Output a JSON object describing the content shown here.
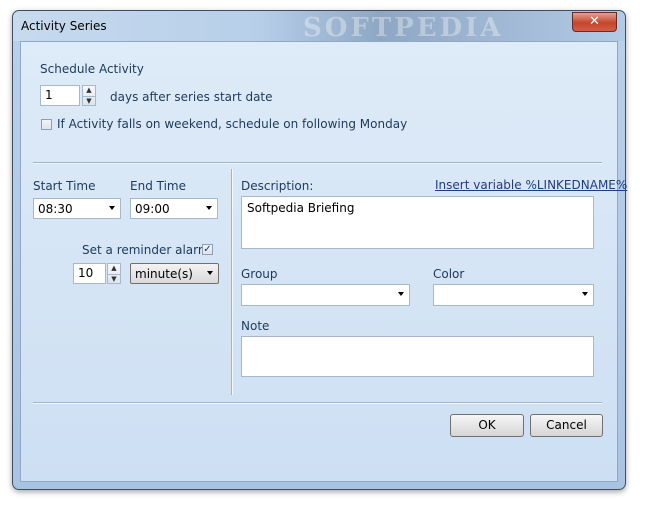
{
  "window": {
    "title": "Activity Series",
    "watermark": "SOFTPEDIA",
    "close_glyph": "✕"
  },
  "schedule": {
    "heading": "Schedule Activity",
    "days_value": "1",
    "days_label": "days after series start date",
    "weekend_label": "If Activity falls on weekend, schedule on following Monday",
    "weekend_checked": false
  },
  "time": {
    "start_label": "Start Time",
    "start_value": "08:30",
    "end_label": "End Time",
    "end_value": "09:00"
  },
  "reminder": {
    "label": "Set a reminder alarm",
    "checked": true,
    "check_glyph": "✓",
    "amount": "10",
    "unit": "minute(s)"
  },
  "details": {
    "description_label": "Description:",
    "insert_variable_link": "Insert variable %LINKEDNAME%",
    "description_value": "Softpedia Briefing",
    "group_label": "Group",
    "group_value": "",
    "color_label": "Color",
    "color_value": "",
    "note_label": "Note",
    "note_value": ""
  },
  "buttons": {
    "ok": "OK",
    "cancel": "Cancel"
  },
  "glyphs": {
    "up": "▲",
    "down": "▼"
  }
}
